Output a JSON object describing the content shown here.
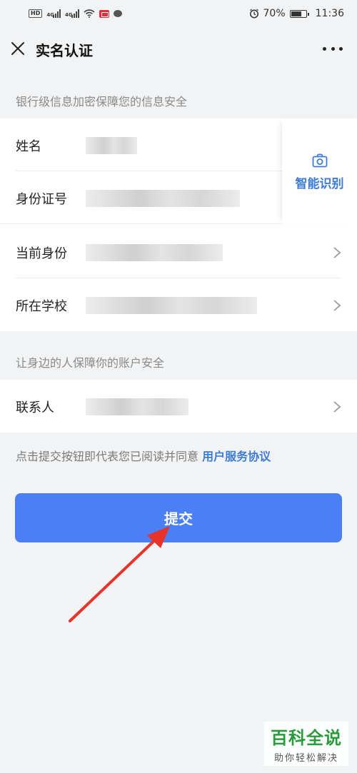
{
  "status_bar": {
    "badge_hd": "HD",
    "net_1": "4G",
    "net_2": "4G",
    "battery": "70%",
    "time": "11:36",
    "battery_level_percent": 70
  },
  "nav": {
    "title": "实名认证"
  },
  "section1": {
    "hint": "银行级信息加密保障您的信息安全"
  },
  "rows": [
    {
      "label": "姓名"
    },
    {
      "label": "身份证号"
    },
    {
      "label": "当前身份"
    },
    {
      "label": "所在学校"
    }
  ],
  "smart_recognize": {
    "label": "智能识别"
  },
  "section2": {
    "hint": "让身边的人保障你的账户安全"
  },
  "contact": {
    "label": "联系人"
  },
  "agreement": {
    "text": "点击提交按钮即代表您已阅读并同意 ",
    "link": "用户服务协议"
  },
  "submit": {
    "label": "提交"
  },
  "watermark": {
    "main": "百科全说",
    "sub": "助你轻松解决"
  },
  "colors": {
    "accent": "#4a7ff6",
    "link": "#3d7bd9",
    "arrow": "#e8332a"
  }
}
